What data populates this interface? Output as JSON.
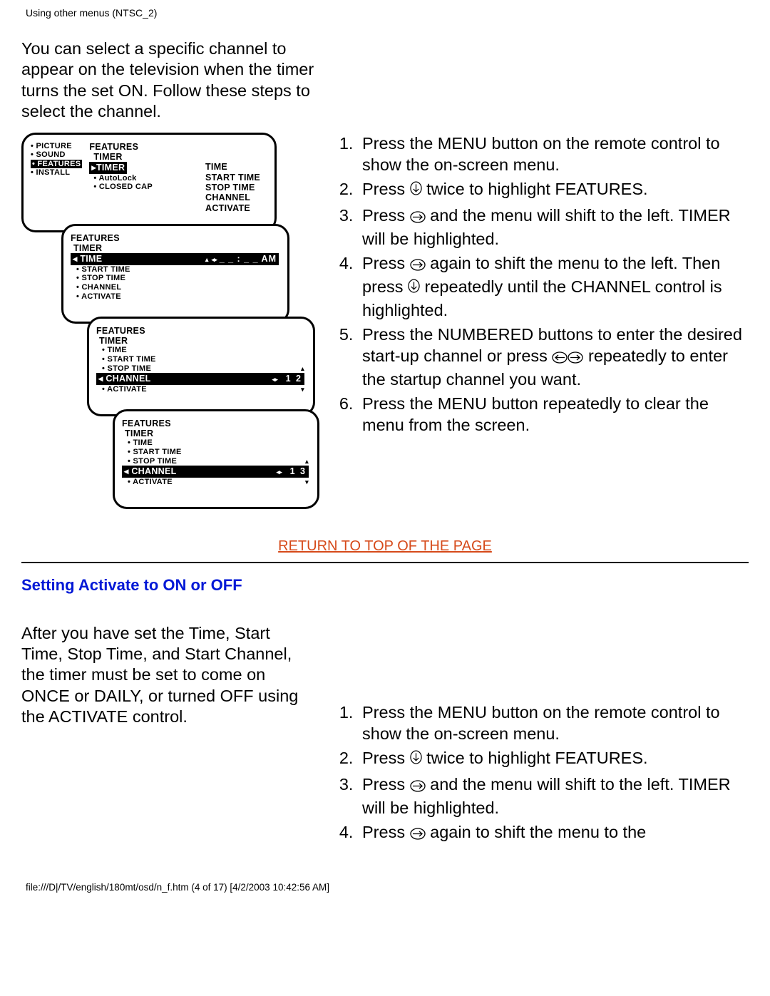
{
  "header": "Using other menus (NTSC_2)",
  "section1": {
    "intro": "You can select a specific channel to appear on the television when the timer turns the set ON. Follow these steps to select the channel.",
    "steps": [
      {
        "pre": "Press the MENU button on the remote control to show the on-screen menu."
      },
      {
        "pre": "Press ",
        "icon": "down",
        "post": " twice to highlight FEATURES."
      },
      {
        "pre": "Press ",
        "icon": "right",
        "post": " and the menu will shift to the left. TIMER will be highlighted."
      },
      {
        "pre": "Press ",
        "icon": "right",
        "mid": " again to shift the menu to the left. Then press ",
        "icon2": "down",
        "post": " repeatedly until the CHANNEL control is highlighted."
      },
      {
        "pre": "Press the NUMBERED buttons to enter the desired start-up channel or press ",
        "icon": "left",
        "icon2": "right",
        "post": " repeatedly to enter the startup channel you want."
      },
      {
        "pre": "Press the MENU button repeatedly to clear the menu from the screen."
      }
    ]
  },
  "osd": {
    "side": [
      "• PICTURE",
      "• SOUND",
      "• FEATURES",
      "• INSTALL"
    ],
    "s1": {
      "title": "FEATURES",
      "sub": "TIMER",
      "hl": "▸TIMER",
      "items": [
        "• AutoLock",
        "• CLOSED CAP"
      ],
      "right": [
        "TIME",
        "START TIME",
        "STOP TIME",
        "CHANNEL",
        "ACTIVATE"
      ]
    },
    "s2": {
      "title": "FEATURES",
      "sub": "TIMER",
      "hl": "◂ TIME",
      "hlval": "_  _ : _  _    AM",
      "items": [
        "• START TIME",
        "• STOP TIME",
        "• CHANNEL",
        "• ACTIVATE"
      ]
    },
    "s3": {
      "title": "FEATURES",
      "sub": "TIMER",
      "items_top": [
        "• TIME",
        "• START TIME",
        "• STOP TIME"
      ],
      "hl": "◂ CHANNEL",
      "hlval": "1 2",
      "items_bot": [
        "• ACTIVATE"
      ]
    },
    "s4": {
      "title": "FEATURES",
      "sub": "TIMER",
      "items_top": [
        "• TIME",
        "• START TIME",
        "• STOP TIME"
      ],
      "hl": "◂ CHANNEL",
      "hlval": "1 3",
      "items_bot": [
        "• ACTIVATE"
      ]
    }
  },
  "return_link": "RETURN TO TOP OF THE PAGE",
  "section2": {
    "heading": "Setting Activate to ON or OFF",
    "intro": "After you have set the Time, Start Time, Stop Time, and Start Channel, the timer must be set to come on ONCE or DAILY, or turned OFF using the ACTIVATE control.",
    "steps": [
      {
        "pre": "Press the MENU button on the remote control to show the on-screen menu."
      },
      {
        "pre": "Press ",
        "icon": "down",
        "post": " twice to highlight FEATURES."
      },
      {
        "pre": "Press ",
        "icon": "right",
        "post": " and the menu will shift to the left. TIMER will be highlighted."
      },
      {
        "pre": "Press ",
        "icon": "right",
        "post": " again to shift the menu to the"
      }
    ]
  },
  "footer": "file:///D|/TV/english/180mt/osd/n_f.htm (4 of 17) [4/2/2003 10:42:56 AM]"
}
